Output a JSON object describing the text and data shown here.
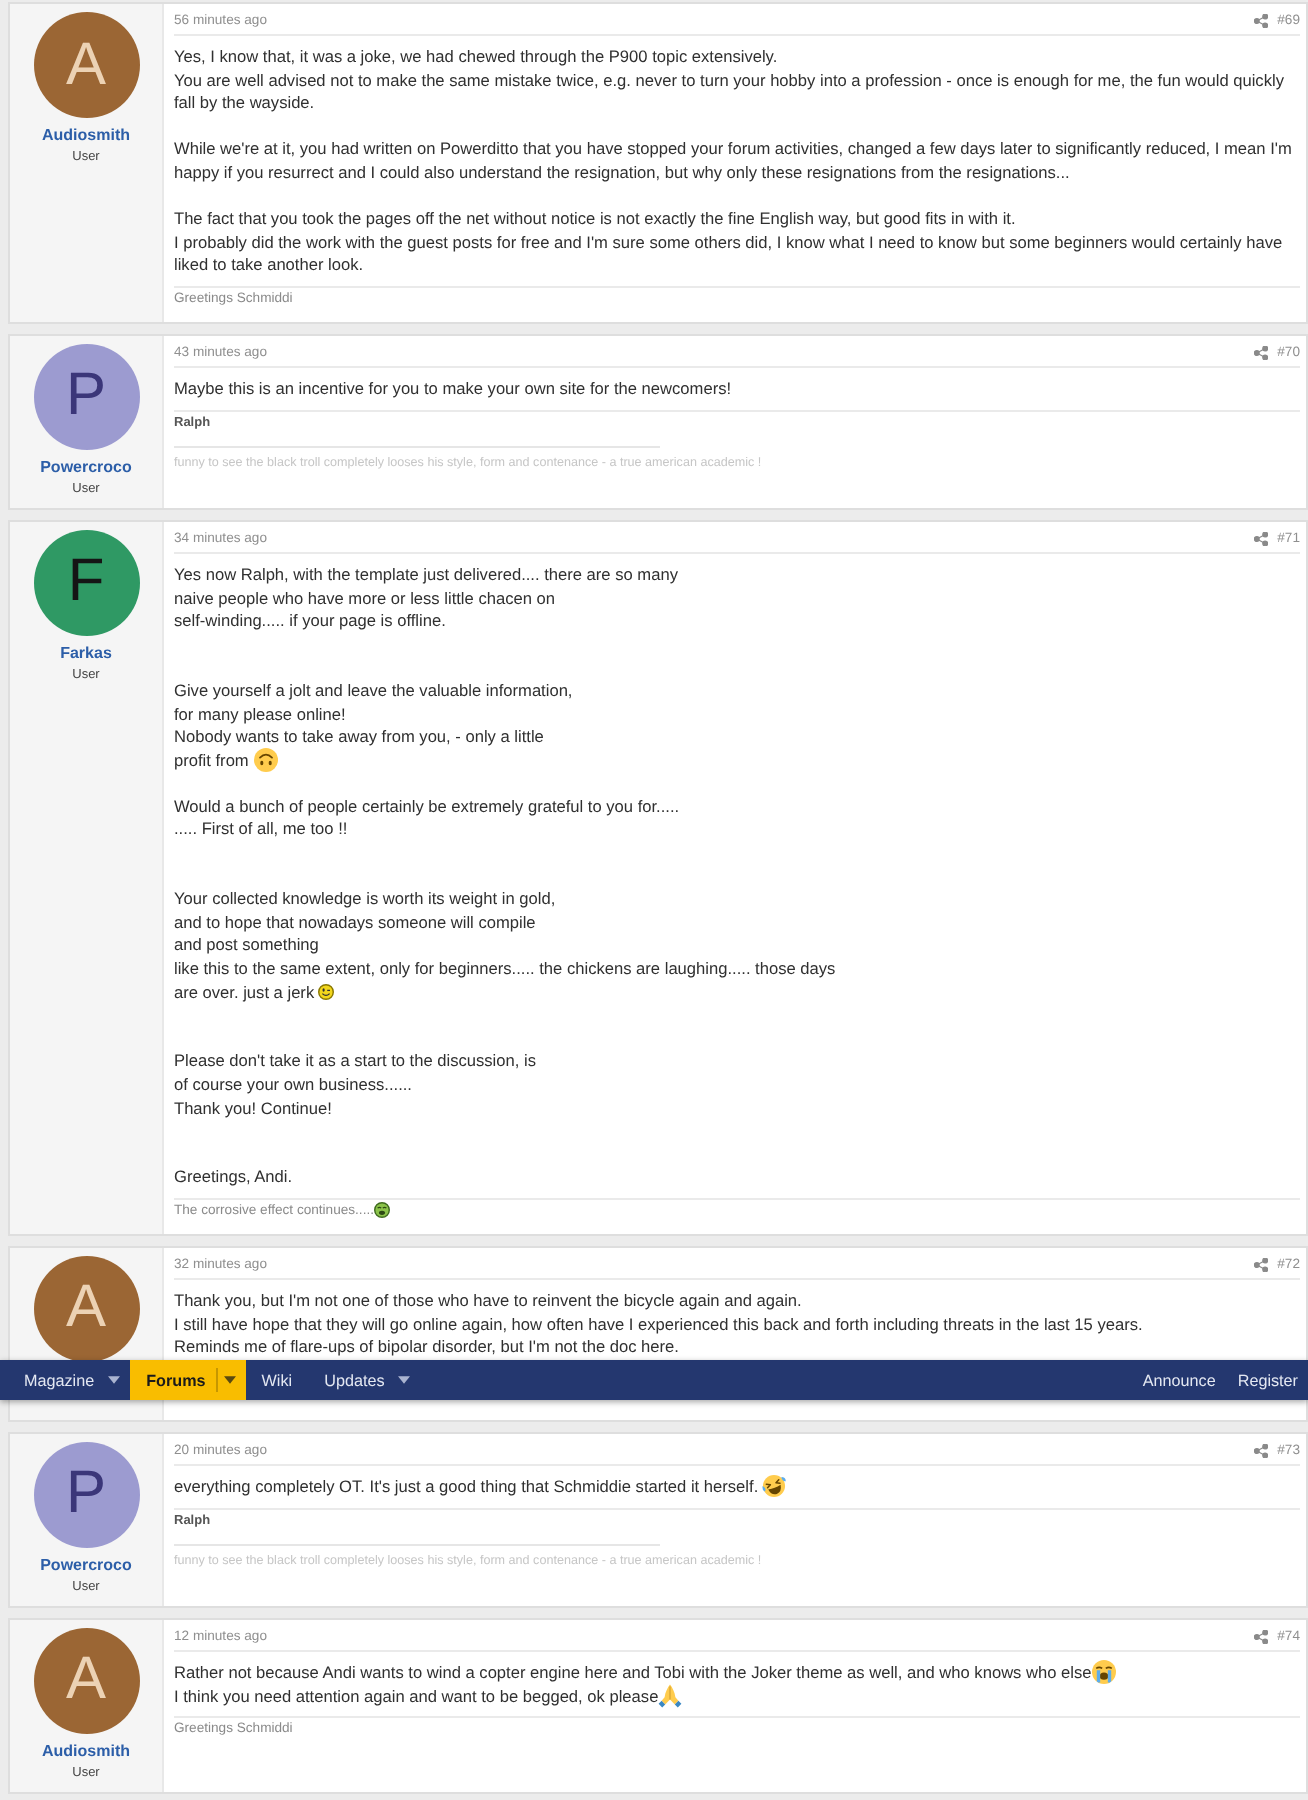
{
  "nav": {
    "tabs": [
      {
        "label": "Magazine",
        "selected": false,
        "has_menu": true
      },
      {
        "label": "Forums",
        "selected": true,
        "has_menu": true
      },
      {
        "label": "Wiki",
        "selected": false,
        "has_menu": false
      },
      {
        "label": "Updates",
        "selected": false,
        "has_menu": true
      }
    ],
    "links": [
      "Announce",
      "Register"
    ]
  },
  "posts": [
    {
      "avatar": {
        "color": "#9b6634",
        "letter": {
          "text": "A",
          "color": "#ecd2b4"
        }
      },
      "author": "Audiosmith",
      "role": "User",
      "time": "56 minutes ago",
      "number": "#69",
      "body": [
        {
          "kind": "text",
          "text": "Yes, I know that, it was a joke, we had chewed through the P900 topic extensively.\nYou are well advised not to make the same mistake twice, e.g. never to turn your hobby into a profession - once is enough for me, the fun would quickly fall by the wayside."
        },
        {
          "kind": "text",
          "text": "\n\nWhile we're at it, you had written on Powerditto that you have stopped your forum activities, changed a few days later to significantly reduced, I mean I'm happy if you resurrect and I could also understand the resignation, but why only these resignations from the resignations..."
        },
        {
          "kind": "text",
          "text": "\n\nThe fact that you took the pages off the net without notice is not exactly the fine English way, but good fits in with it.\nI probably did the work with the guest posts for free and I'm sure some others did, I know what I need to know but some beginners would certainly have liked to take another look."
        }
      ],
      "signature": [
        {
          "kind": "text",
          "text": "Greetings Schmiddi"
        }
      ]
    },
    {
      "avatar": {
        "color": "#9c9bd0",
        "letter": {
          "text": "P",
          "color": "#3b3679"
        }
      },
      "author": "Powercroco",
      "role": "User",
      "time": "43 minutes ago",
      "number": "#70",
      "body": [
        {
          "kind": "text",
          "text": "Maybe this is an incentive for you to make your own site for the newcomers!"
        }
      ],
      "signature": [
        {
          "kind": "name",
          "text": "Ralph"
        },
        {
          "kind": "quote",
          "text": "funny to see the black troll completely looses his style, form and contenance - a true american academic !"
        }
      ]
    },
    {
      "avatar": {
        "color": "#2f9964",
        "letter": {
          "text": "F",
          "color": "#151515"
        }
      },
      "author": "Farkas",
      "role": "User",
      "time": "34 minutes ago",
      "number": "#71",
      "body": [
        {
          "kind": "text",
          "text": "Yes now Ralph, with the template just delivered.... there are so many\nnaive people who have more or less little chacen on\nself-winding..... if your page is offline."
        },
        {
          "kind": "text",
          "text": "\n\n\nGive yourself a jolt and leave the valuable information,\nfor many please online!\nNobody wants to take away from you, - only a little"
        },
        {
          "kind": "text",
          "text": "\nprofit from "
        },
        {
          "kind": "upside-down-face"
        },
        {
          "kind": "text",
          "text": "\n\nWould a bunch of people certainly be extremely grateful to you for.....\n..... First of all, me too !!"
        },
        {
          "kind": "text",
          "text": "\n\n\nYour collected knowledge is worth its weight in gold,\nand to hope that nowadays someone will compile\nand post something\nlike this to the same extent, only for beginners..... the chickens are laughing..... those days"
        },
        {
          "kind": "text",
          "text": "\nare over. just a jerk "
        },
        {
          "kind": "winking-face"
        },
        {
          "kind": "text",
          "text": "\n\n\nPlease don't take it as a start to the discussion, is\nof course your own business......\nThank you! Continue!"
        },
        {
          "kind": "text",
          "text": "\n\n\nGreetings, Andi."
        }
      ],
      "signature": [
        {
          "kind": "text",
          "text": "The corrosive effect continues....."
        },
        {
          "kind": "vomiting-face"
        }
      ]
    },
    {
      "avatar": {
        "color": "#9b6634",
        "letter": {
          "text": "A",
          "color": "#ecd2b4"
        }
      },
      "time": "32 minutes ago",
      "number": "#72",
      "body": [
        {
          "kind": "text",
          "text": "Thank you, but I'm not one of those who have to reinvent the bicycle again and again.\nI still have hope that they will go online again, how often have I experienced this back and forth including threats in the last 15 years.\nReminds me of flare-ups of bipolar disorder, but I'm not the doc here."
        }
      ]
    },
    {
      "avatar": {
        "color": "#9c9bd0",
        "letter": {
          "text": "P",
          "color": "#3b3679"
        }
      },
      "author": "Powercroco",
      "role": "User",
      "time": "20 minutes ago",
      "number": "#73",
      "body": [
        {
          "kind": "text",
          "text": "everything completely OT. It's just a good thing that Schmiddie started it herself. "
        },
        {
          "kind": "laughing-face"
        }
      ],
      "signature": [
        {
          "kind": "name",
          "text": "Ralph"
        },
        {
          "kind": "quote",
          "text": "funny to see the black troll completely looses his style, form and contenance - a true american academic !"
        }
      ]
    },
    {
      "avatar": {
        "color": "#9b6634",
        "letter": {
          "text": "A",
          "color": "#ecd2b4"
        }
      },
      "author": "Audiosmith",
      "role": "User",
      "time": "12 minutes ago",
      "number": "#74",
      "body": [
        {
          "kind": "text",
          "text": "Rather not because Andi wants to wind a copter engine here and Tobi with the Joker theme as well, and who knows who else"
        },
        {
          "kind": "crying-face"
        },
        {
          "kind": "text",
          "text": "\nI think you need attention again and want to be begged, ok please"
        },
        {
          "kind": "praying-hands"
        }
      ],
      "signature": [
        {
          "kind": "text",
          "text": "Greetings Schmiddi"
        }
      ]
    }
  ]
}
